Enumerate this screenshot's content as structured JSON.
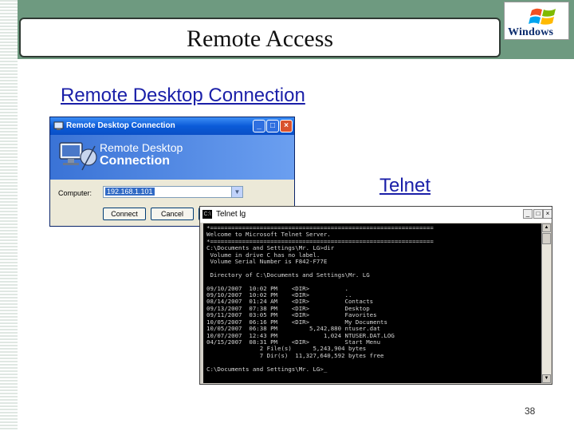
{
  "slide": {
    "title": "Remote Access",
    "logo_text": "Windows",
    "page_number": "38"
  },
  "sections": {
    "rdc_heading": "Remote Desktop Connection",
    "telnet_heading": "Telnet"
  },
  "rdc": {
    "window_title": "Remote Desktop Connection",
    "banner_line1": "Remote Desktop",
    "banner_line2": "Connection",
    "computer_label": "Computer:",
    "computer_value": "192.168.1.101",
    "buttons": {
      "connect": "Connect",
      "cancel": "Cancel"
    }
  },
  "telnet": {
    "window_title": "Telnet lg",
    "console_lines": [
      "*===============================================================",
      "Welcome to Microsoft Telnet Server.",
      "*===============================================================",
      "C:\\Documents and Settings\\Mr. LG>dir",
      " Volume in drive C has no label.",
      " Volume Serial Number is F842-F77E",
      "",
      " Directory of C:\\Documents and Settings\\Mr. LG",
      "",
      "09/10/2007  10:02 PM    <DIR>          .",
      "09/10/2007  10:02 PM    <DIR>          ..",
      "08/14/2007  01:24 AM    <DIR>          Contacts",
      "09/13/2007  07:38 PM    <DIR>          Desktop",
      "09/11/2007  03:05 PM    <DIR>          Favorites",
      "10/05/2007  06:16 PM    <DIR>          My Documents",
      "10/05/2007  06:38 PM         5,242,880 ntuser.dat",
      "10/07/2007  12:43 PM             1,024 NTUSER.DAT.LOG",
      "04/15/2007  08:31 PM    <DIR>          Start Menu",
      "               2 File(s)      5,243,904 bytes",
      "               7 Dir(s)  11,327,640,592 bytes free",
      "",
      "C:\\Documents and Settings\\Mr. LG>_"
    ]
  },
  "colors": {
    "band": "#6e9a80",
    "heading": "#1a1fa8",
    "xp_title": "#0b5bd8",
    "console_bg": "#000000"
  }
}
